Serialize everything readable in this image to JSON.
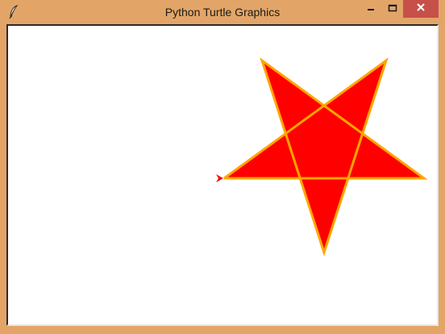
{
  "window": {
    "title": "Python Turtle Graphics",
    "app_icon": "feather-icon",
    "controls": {
      "minimize": "minimize-icon",
      "maximize": "maximize-icon",
      "close": "close-icon"
    }
  },
  "canvas": {
    "background": "#ffffff",
    "star": {
      "fill_color": "#ff0000",
      "stroke_color": "#ffa500"
    },
    "turtle": {
      "icon": "turtle-arrow-icon",
      "color": "#ff0000"
    }
  },
  "colors": {
    "frame": "#e3a567",
    "close_button": "#c7504a"
  }
}
